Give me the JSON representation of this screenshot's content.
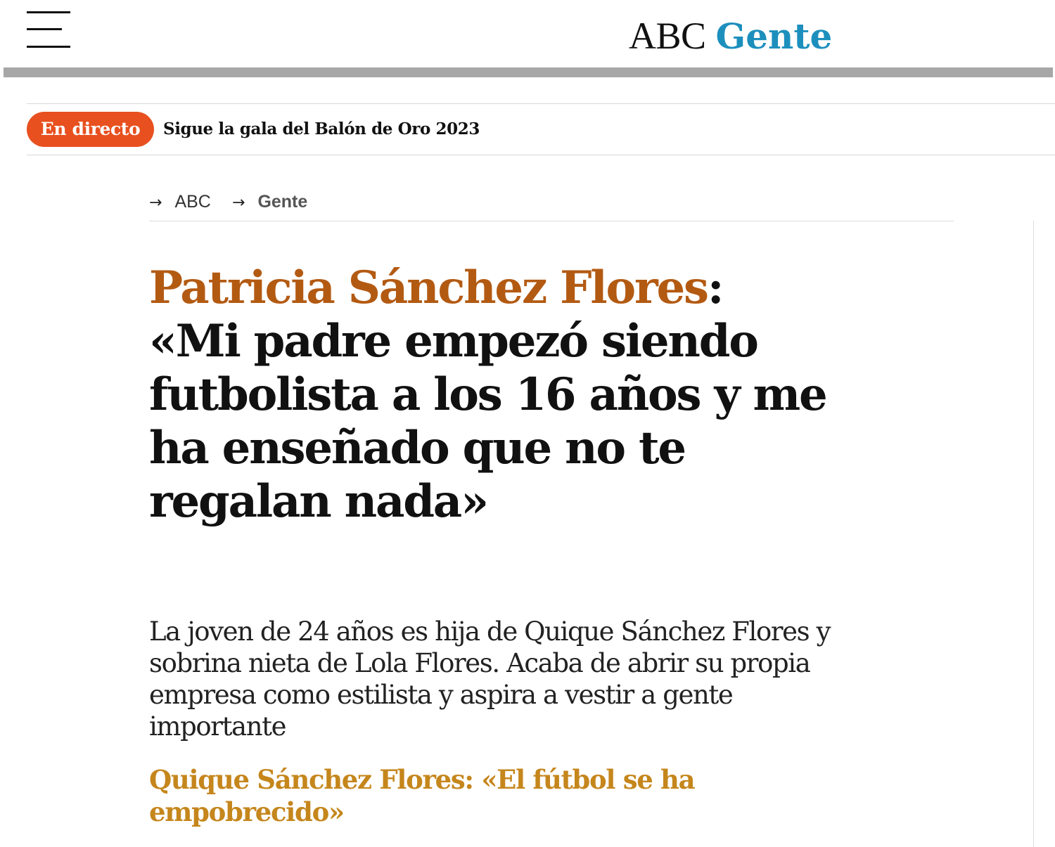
{
  "header": {
    "menu_icon": "hamburger-menu-icon",
    "brand": "ABC",
    "section": "Gente",
    "section_color": "#1d8fbd"
  },
  "live": {
    "badge": "En directo",
    "badge_color": "#e8501f",
    "headline": "Sigue la gala del Balón de Oro 2023"
  },
  "breadcrumb": {
    "arrow_icon": "right-arrow-icon",
    "items": [
      "ABC",
      "Gente"
    ]
  },
  "article": {
    "headline_name": "Patricia Sánchez Flores",
    "headline_sep": ":",
    "headline_quote": "«Mi padre empezó siendo futbolista a los 16 años y me ha enseñado que no te regalan nada»",
    "name_color": "#b35a12",
    "subtitle": "La joven de 24 años es hija de Quique Sánchez Flores y sobrina nieta de Lola Flores. Acaba de abrir su propia empresa como estilista y aspira a vestir a gente importante",
    "related_link": "Quique Sánchez Flores: «El fútbol se ha empobrecido»",
    "related_color": "#c5861c"
  }
}
